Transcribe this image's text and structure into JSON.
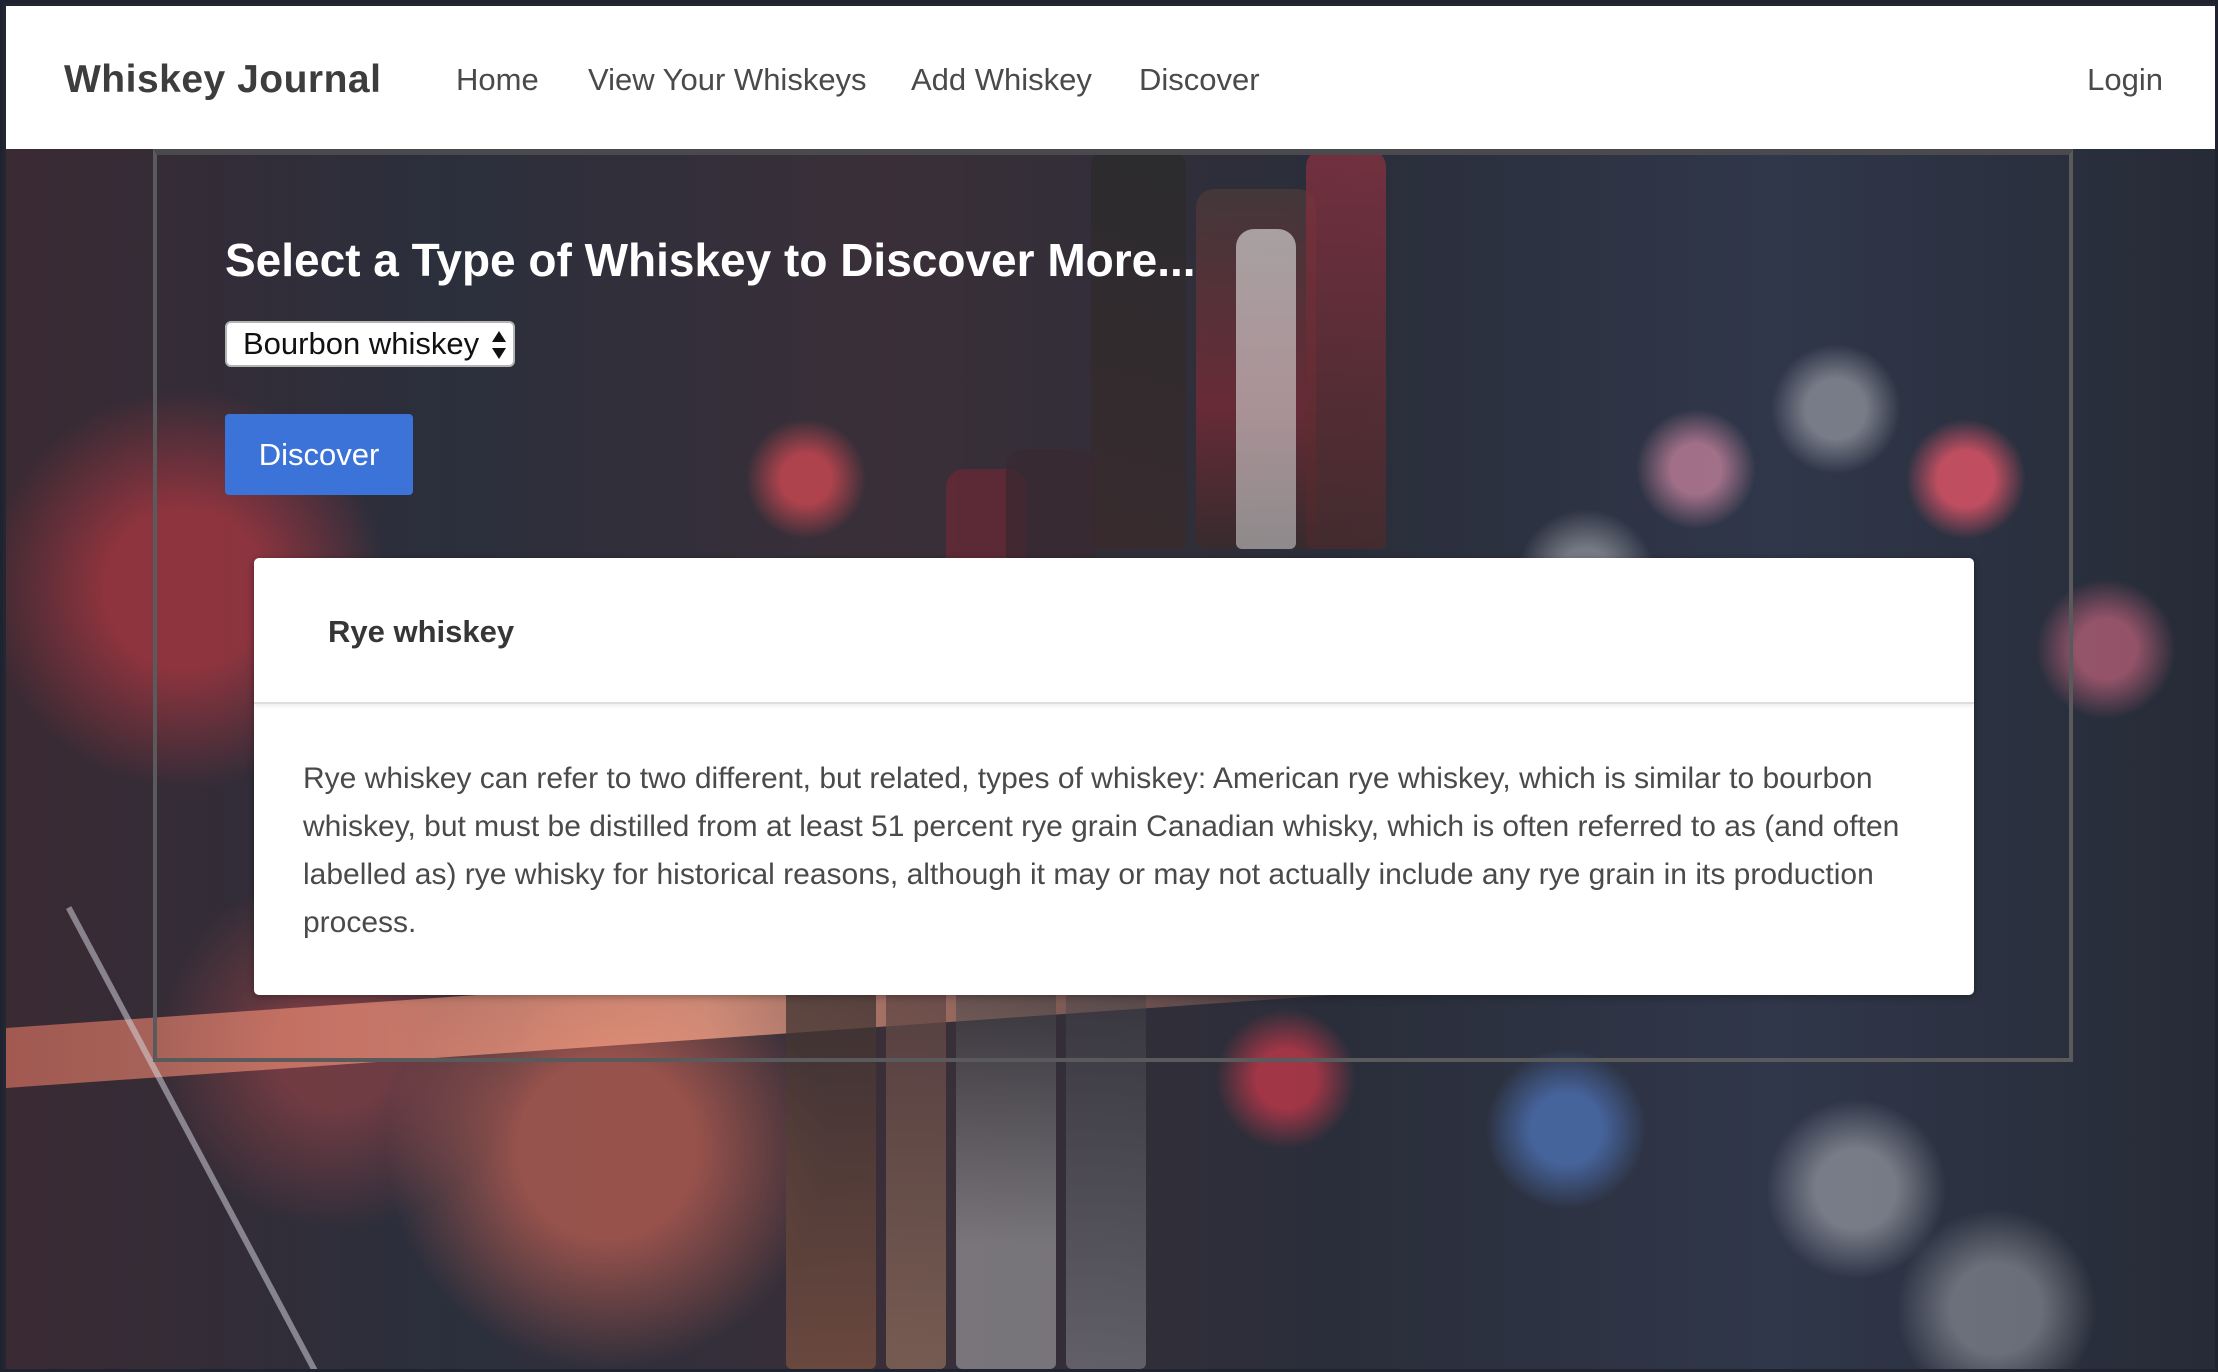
{
  "navbar": {
    "brand": "Whiskey Journal",
    "links": [
      "Home",
      "View Your Whiskeys",
      "Add Whiskey",
      "Discover"
    ],
    "login": "Login"
  },
  "main": {
    "heading": "Select a Type of Whiskey to Discover More...",
    "select": {
      "selected": "Bourbon whiskey"
    },
    "discover_button": "Discover",
    "card": {
      "title": "Rye whiskey",
      "body": "Rye whiskey can refer to two different, but related, types of whiskey: American rye whiskey, which is similar to bourbon whiskey, but must be distilled from at least 51 percent rye grain Canadian whisky, which is often referred to as (and often labelled as) rye whisky for historical reasons, although it may or may not actually include any rye grain in its production process."
    }
  },
  "colors": {
    "primary": "#3b73d8",
    "navbar_bg": "#ffffff",
    "text": "#4a4a4a"
  },
  "icons": {
    "select_arrows": "up-down-arrows-icon"
  }
}
